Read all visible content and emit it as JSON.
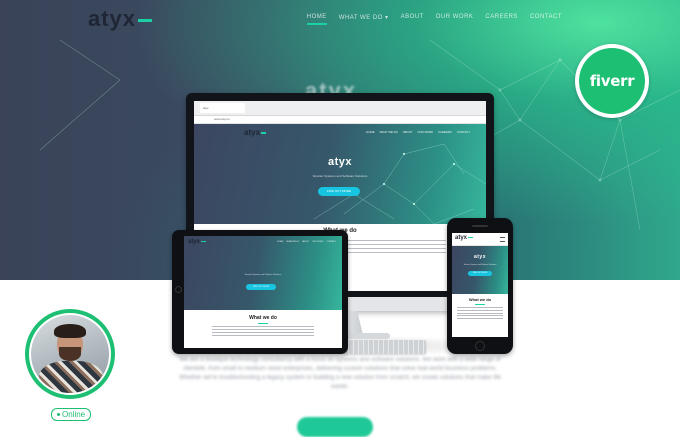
{
  "background_site": {
    "logo": "atyx",
    "nav": [
      "HOME",
      "WHAT WE DO ▾",
      "ABOUT",
      "OUR WORK",
      "CAREERS",
      "CONTACT"
    ],
    "hero_title": "atyx",
    "body_text": "We are a boutique technology consultancy with a focus on systems and software solutions. We work with a wide range of clientele, from small to medium sized enterprises, delivering custom solutions that solve real-world business problems. Whether we're troubleshooting a legacy system or building a new solution from scratch, we create solutions that make life easier."
  },
  "badge": {
    "label": "fiverr",
    "color": "#1dbf73"
  },
  "mockup": {
    "logo": "atyx",
    "nav": [
      "HOME",
      "WHAT WE DO",
      "ABOUT",
      "OUR WORK",
      "CAREERS",
      "CONTACT"
    ],
    "hero_title": "atyx",
    "hero_subtitle": "Smarter Systems and Software Solutions",
    "cta": "FIND OUT MORE",
    "section_title": "What we do",
    "browser_tab": "atyx",
    "browser_url": "www.atyx.io"
  },
  "profile": {
    "status": "Online",
    "status_color": "#1dbf73"
  },
  "colors": {
    "accent": "#1ad1a5",
    "button": "#18c5e0"
  }
}
